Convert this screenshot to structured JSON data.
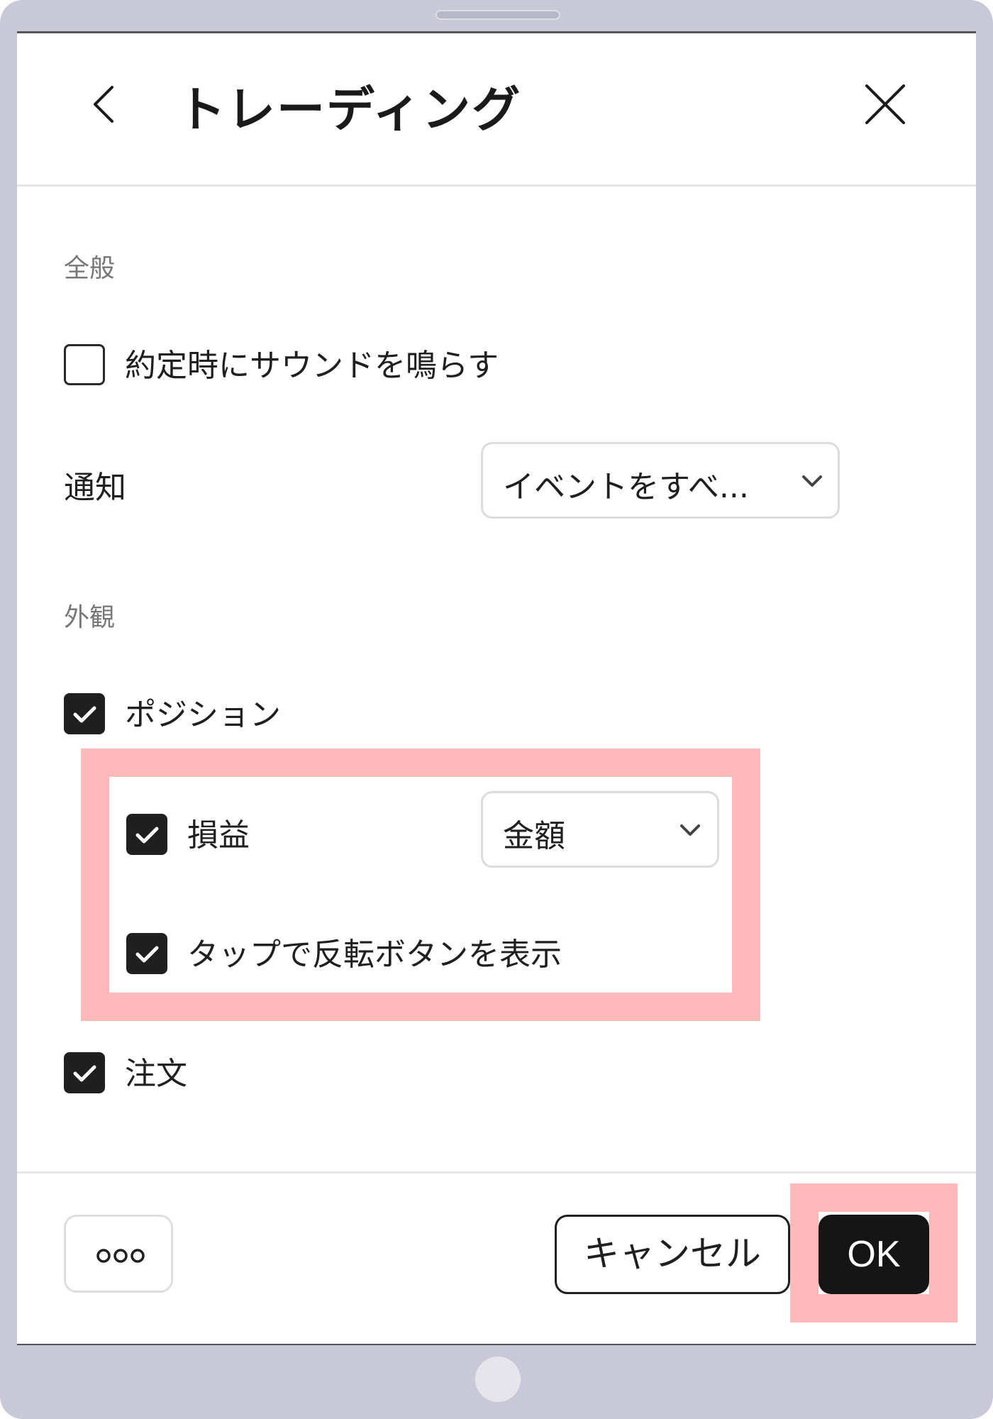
{
  "header": {
    "title": "トレーディング",
    "back_icon": "chevron-left-icon",
    "close_icon": "close-icon"
  },
  "general": {
    "section_label": "全般",
    "sound_on_fill": {
      "label": "約定時にサウンドを鳴らす",
      "checked": false
    },
    "notifications": {
      "label": "通知",
      "selected_value": "イベントをすべ..."
    }
  },
  "appearance": {
    "section_label": "外観",
    "positions": {
      "label": "ポジション",
      "checked": true
    },
    "pnl": {
      "label": "損益",
      "checked": true,
      "selected_value": "金額"
    },
    "reverse_button": {
      "label": "タップで反転ボタンを表示",
      "checked": true
    },
    "orders": {
      "label": "注文",
      "checked": true
    }
  },
  "footer": {
    "more_icon": "more-horizontal-icon",
    "cancel_label": "キャンセル",
    "ok_label": "OK"
  },
  "colors": {
    "frame": "#c9c8d6",
    "highlight": "#ffb9b9",
    "checkbox_checked": "#1f1f1f",
    "ok_button": "#151515"
  }
}
